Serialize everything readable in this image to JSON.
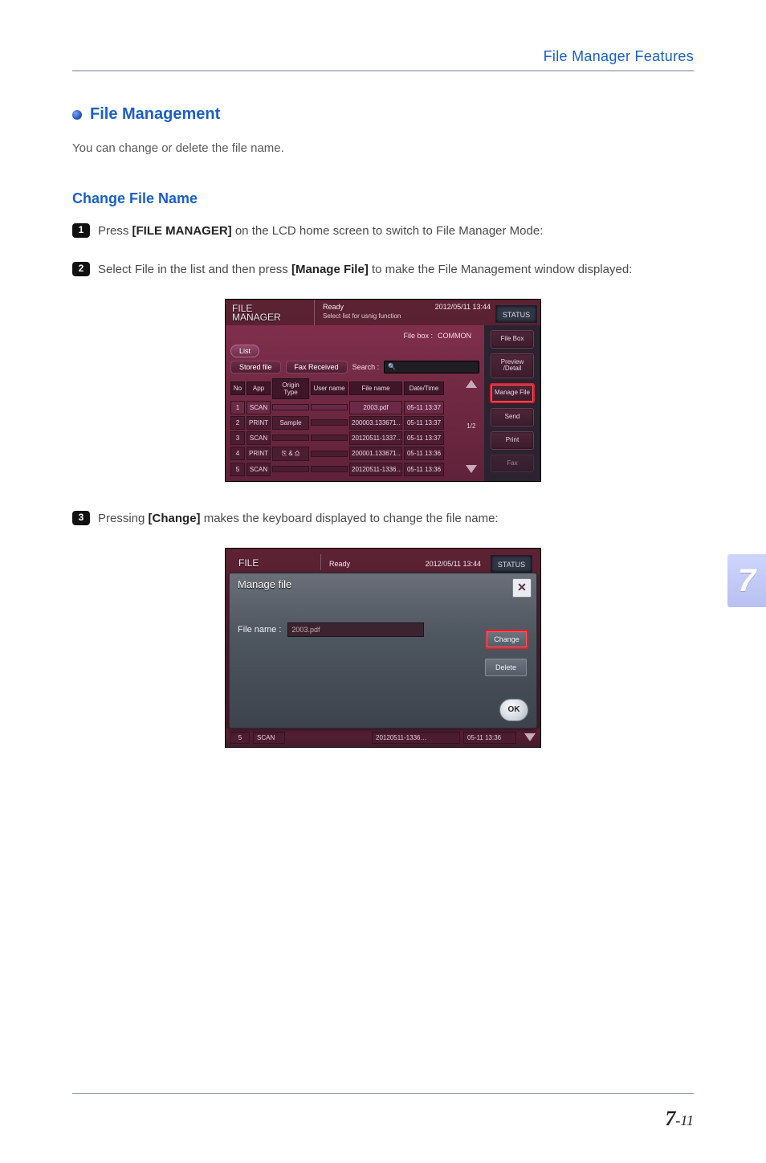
{
  "header": {
    "right": "File Manager Features"
  },
  "section": {
    "title": "File Management",
    "intro": "You can change or delete the file name."
  },
  "sub1": {
    "title": "Change File Name",
    "step1_a": "Press ",
    "step1_b": "[FILE MANAGER]",
    "step1_c": " on the LCD home screen to switch to File Manager Mode:",
    "step2_a": "Select File in the list and then press ",
    "step2_b": "[Manage File]",
    "step2_c": " to make the File Management window displayed:",
    "step3_a": "Pressing ",
    "step3_b": "[Change]",
    "step3_c": " makes the keyboard displayed to change the file name:"
  },
  "shot1": {
    "title1": "FILE",
    "title2": "MANAGER",
    "ready": "Ready",
    "subready": "Select list for usnig function",
    "timestamp": "2012/05/11 13:44",
    "status_btn": "STATUS",
    "tabs": {
      "list": "List",
      "stored": "Stored file",
      "fax": "Fax Received"
    },
    "filebox_label": "File box :",
    "filebox_value": "COMMON",
    "search_label": "Search :",
    "cols": {
      "no": "No",
      "app": "App",
      "origin": "Origin Type",
      "user": "User name",
      "file": "File name",
      "date": "Date/Time"
    },
    "rows": [
      {
        "no": "1",
        "app": "SCAN",
        "origin": "",
        "user": "",
        "file": "2003.pdf",
        "date": "05-11 13:37",
        "sel": true
      },
      {
        "no": "2",
        "app": "PRINT",
        "origin": "Sample",
        "user": "",
        "file": "200003.133671…",
        "date": "05-11 13:37"
      },
      {
        "no": "3",
        "app": "SCAN",
        "origin": "",
        "user": "",
        "file": "20120511-1337…",
        "date": "05-11 13:37"
      },
      {
        "no": "4",
        "app": "PRINT",
        "origin": "⎘ & ⎙",
        "user": "",
        "file": "200001.133671…",
        "date": "05-11 13:36"
      },
      {
        "no": "5",
        "app": "SCAN",
        "origin": "",
        "user": "",
        "file": "20120511-1336…",
        "date": "05-11 13:36"
      }
    ],
    "page": "1/2",
    "side": {
      "filebox": "File Box",
      "preview": "Preview /Detail",
      "manage": "Manage File",
      "send": "Send",
      "print": "Print",
      "fax": "Fax"
    }
  },
  "shot2": {
    "title1": "FILE",
    "ready": "Ready",
    "timestamp": "2012/05/11 13:44",
    "status_btn": "STATUS",
    "dialog_title": "Manage file",
    "fn_label": "File name :",
    "fn_value": "2003.pdf",
    "change": "Change",
    "delete": "Delete",
    "ok": "OK",
    "foot_no": "5",
    "foot_app": "SCAN",
    "foot_file": "20120511-1336…",
    "foot_date": "05-11 13:36"
  },
  "chapter": "7",
  "footer": {
    "big": "7",
    "small": "-11"
  }
}
